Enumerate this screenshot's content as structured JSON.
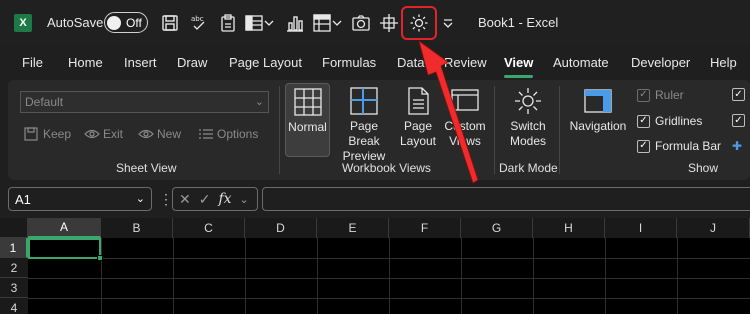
{
  "titlebar": {
    "autosave_label": "AutoSave",
    "autosave_state": "Off",
    "book_title": "Book1  -  Excel"
  },
  "tabs": [
    "File",
    "Home",
    "Insert",
    "Draw",
    "Page Layout",
    "Formulas",
    "Data",
    "Review",
    "View",
    "Automate",
    "Developer",
    "Help"
  ],
  "active_tab": "View",
  "ribbon": {
    "sheet_view": {
      "dropdown_value": "Default",
      "buttons": [
        "Keep",
        "Exit",
        "New",
        "Options"
      ],
      "label": "Sheet View"
    },
    "workbook_views": {
      "normal": "Normal",
      "page_break_1": "Page Break",
      "page_break_2": "Preview",
      "page_layout_1": "Page",
      "page_layout_2": "Layout",
      "custom_views_1": "Custom",
      "custom_views_2": "Views",
      "label": "Workbook Views"
    },
    "dark_mode": {
      "switch_1": "Switch",
      "switch_2": "Modes",
      "label": "Dark Mode"
    },
    "show": {
      "navigation": "Navigation",
      "ruler": "Ruler",
      "gridlines": "Gridlines",
      "formula_bar": "Formula Bar",
      "label": "Show"
    }
  },
  "formula_bar": {
    "name_box": "A1",
    "fx": "fx"
  },
  "grid": {
    "columns": [
      "A",
      "B",
      "C",
      "D",
      "E",
      "F",
      "G",
      "H",
      "I",
      "J"
    ],
    "rows": [
      "1",
      "2",
      "3",
      "4"
    ]
  },
  "colors": {
    "accent": "#3aa76d",
    "highlight": "#e0252a",
    "arrow": "#ef2b2b"
  }
}
